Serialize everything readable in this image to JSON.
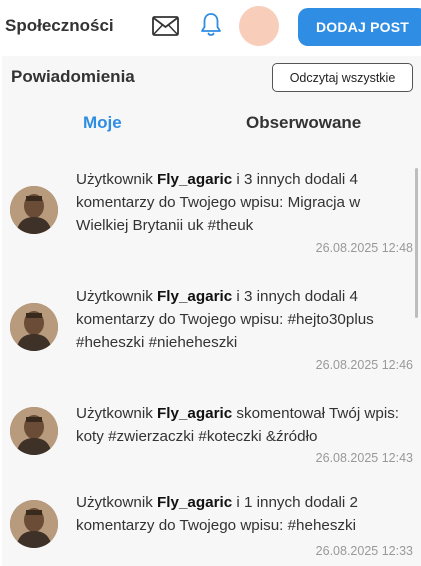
{
  "header": {
    "communities_label": "Społeczności",
    "add_post_label": "DODAJ POST",
    "icons": {
      "mail": "mail-icon",
      "bell": "bell-icon"
    },
    "accent_color": "#2f8de4",
    "avatar_color": "#f8cdb9"
  },
  "panel": {
    "title": "Powiadomienia",
    "read_all_label": "Odczytaj wszystkie",
    "tabs": [
      {
        "label": "Moje",
        "active": true
      },
      {
        "label": "Obserwowane",
        "active": false
      }
    ]
  },
  "notifications": [
    {
      "prefix": "Użytkownik ",
      "user": "Fly_agaric",
      "message": " i 3 innych dodali 4 komentarzy do Twojego wpisu: Migracja w Wielkiej Brytanii uk #theuk",
      "time": "26.08.2025 12:48"
    },
    {
      "prefix": "Użytkownik ",
      "user": "Fly_agaric",
      "message": " i 3 innych dodali 4 komentarzy do Twojego wpisu: #hejto30plus #heheszki #nieheheszki",
      "time": "26.08.2025 12:46"
    },
    {
      "prefix": "Użytkownik ",
      "user": "Fly_agaric",
      "message": " skomentował Twój wpis: koty #zwierzaczki #koteczki &źródło",
      "time": "26.08.2025 12:43"
    },
    {
      "prefix": "Użytkownik ",
      "user": "Fly_agaric",
      "message": " i 1 innych dodali 2 komentarzy do Twojego wpisu: #heheszki",
      "time": "26.08.2025 12:33"
    }
  ]
}
